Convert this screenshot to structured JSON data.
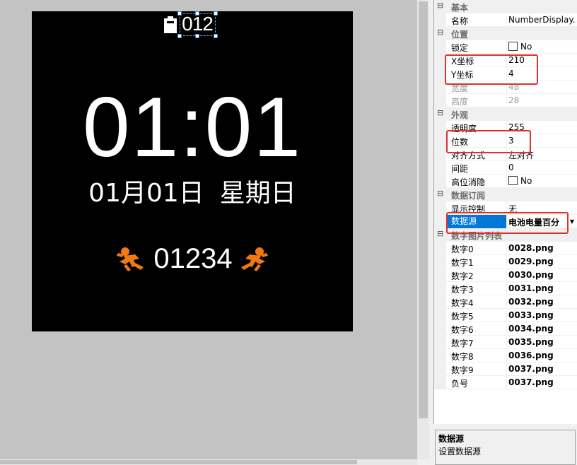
{
  "canvas": {
    "watch": {
      "battery_value": "012",
      "time": "01:01",
      "date": "01月01日",
      "weekday": "星期日",
      "steps": "01234"
    },
    "colors": {
      "runner_accent": "#f07a10",
      "selection": "#0078d7",
      "highlight_box": "#e03030"
    }
  },
  "properties": {
    "groups": [
      {
        "title": "基本",
        "rows": [
          {
            "name": "名称",
            "value": "NumberDisplay..."
          }
        ]
      },
      {
        "title": "位置",
        "rows": [
          {
            "name": "锁定",
            "value": "No",
            "checkbox": true
          },
          {
            "name": "X坐标",
            "value": "210"
          },
          {
            "name": "Y坐标",
            "value": "4"
          },
          {
            "name": "宽度",
            "value": "48",
            "dim": true
          },
          {
            "name": "高度",
            "value": "28",
            "dim": true
          }
        ]
      },
      {
        "title": "外观",
        "rows": [
          {
            "name": "透明度",
            "value": "255"
          },
          {
            "name": "位数",
            "value": "3"
          },
          {
            "name": "对齐方式",
            "value": "左对齐"
          },
          {
            "name": "间距",
            "value": "0"
          },
          {
            "name": "高位消隐",
            "value": "No",
            "checkbox": true
          }
        ]
      },
      {
        "title": "数据订阅",
        "rows": [
          {
            "name": "显示控制",
            "value": "无"
          },
          {
            "name": "数据源",
            "value": "电池电量百分",
            "selected": true,
            "bold": true
          }
        ]
      },
      {
        "title": "数字图片列表",
        "rows": [
          {
            "name": "数字0",
            "value": "0028.png",
            "bold": true
          },
          {
            "name": "数字1",
            "value": "0029.png",
            "bold": true
          },
          {
            "name": "数字2",
            "value": "0030.png",
            "bold": true
          },
          {
            "name": "数字3",
            "value": "0031.png",
            "bold": true
          },
          {
            "name": "数字4",
            "value": "0032.png",
            "bold": true
          },
          {
            "name": "数字5",
            "value": "0033.png",
            "bold": true
          },
          {
            "name": "数字6",
            "value": "0034.png",
            "bold": true
          },
          {
            "name": "数字7",
            "value": "0035.png",
            "bold": true
          },
          {
            "name": "数字8",
            "value": "0036.png",
            "bold": true
          },
          {
            "name": "数字9",
            "value": "0037.png",
            "bold": true
          },
          {
            "name": "负号",
            "value": "0037.png",
            "bold": true
          }
        ]
      }
    ],
    "collapse_glyph": "⊟"
  },
  "description": {
    "title": "数据源",
    "text": "设置数据源"
  }
}
